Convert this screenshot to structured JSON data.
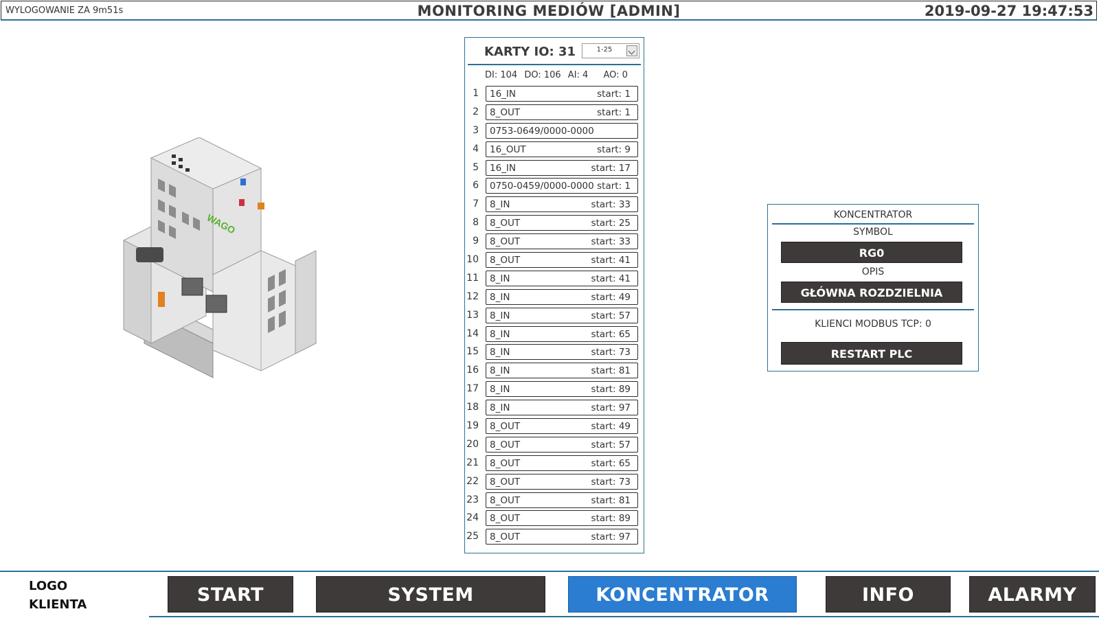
{
  "header": {
    "logout": "WYLOGOWANIE ZA 9m51s",
    "title": "MONITORING MEDIÓW [ADMIN]",
    "datetime": "2019-09-27 19:47:53"
  },
  "device_image": {
    "label": "WAGO"
  },
  "io": {
    "title": "KARTY IO: 31",
    "range_selected": "1-25",
    "counts": {
      "di": "DI: 104",
      "do": "DO: 106",
      "ai": "AI: 4",
      "ao": "AO: 0"
    },
    "cards": [
      {
        "num": "1",
        "name": "16_IN",
        "start": "start: 1"
      },
      {
        "num": "2",
        "name": "8_OUT",
        "start": "start: 1"
      },
      {
        "num": "3",
        "name": "0753-0649/0000-0000",
        "start": ""
      },
      {
        "num": "4",
        "name": "16_OUT",
        "start": "start: 9"
      },
      {
        "num": "5",
        "name": "16_IN",
        "start": "start: 17"
      },
      {
        "num": "6",
        "name": "0750-0459/0000-0000",
        "start": "start: 1"
      },
      {
        "num": "7",
        "name": "8_IN",
        "start": "start: 33"
      },
      {
        "num": "8",
        "name": "8_OUT",
        "start": "start: 25"
      },
      {
        "num": "9",
        "name": "8_OUT",
        "start": "start: 33"
      },
      {
        "num": "10",
        "name": "8_OUT",
        "start": "start: 41"
      },
      {
        "num": "11",
        "name": "8_IN",
        "start": "start: 41"
      },
      {
        "num": "12",
        "name": "8_IN",
        "start": "start: 49"
      },
      {
        "num": "13",
        "name": "8_IN",
        "start": "start: 57"
      },
      {
        "num": "14",
        "name": "8_IN",
        "start": "start: 65"
      },
      {
        "num": "15",
        "name": "8_IN",
        "start": "start: 73"
      },
      {
        "num": "16",
        "name": "8_IN",
        "start": "start: 81"
      },
      {
        "num": "17",
        "name": "8_IN",
        "start": "start: 89"
      },
      {
        "num": "18",
        "name": "8_IN",
        "start": "start: 97"
      },
      {
        "num": "19",
        "name": "8_OUT",
        "start": "start: 49"
      },
      {
        "num": "20",
        "name": "8_OUT",
        "start": "start: 57"
      },
      {
        "num": "21",
        "name": "8_OUT",
        "start": "start: 65"
      },
      {
        "num": "22",
        "name": "8_OUT",
        "start": "start: 73"
      },
      {
        "num": "23",
        "name": "8_OUT",
        "start": "start: 81"
      },
      {
        "num": "24",
        "name": "8_OUT",
        "start": "start: 89"
      },
      {
        "num": "25",
        "name": "8_OUT",
        "start": "start: 97"
      }
    ]
  },
  "concentrator": {
    "title": "KONCENTRATOR",
    "symbol_label": "SYMBOL",
    "symbol_value": "RG0",
    "desc_label": "OPIS",
    "desc_value": "GŁÓWNA ROZDZIELNIA",
    "clients": "KLIENCI MODBUS TCP: 0",
    "restart_label": "RESTART PLC"
  },
  "footer": {
    "logo_line1": "LOGO",
    "logo_line2": "KLIENTA",
    "nav": [
      {
        "label": "START"
      },
      {
        "label": "SYSTEM"
      },
      {
        "label": "KONCENTRATOR",
        "active": true
      },
      {
        "label": "INFO"
      },
      {
        "label": "ALARMY"
      }
    ]
  },
  "colors": {
    "accent": "#2a6f97",
    "button_dark": "#3d3a39",
    "button_active": "#2a7dd1"
  }
}
